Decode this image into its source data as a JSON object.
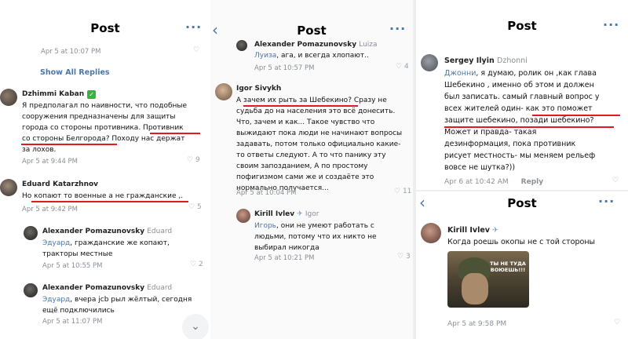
{
  "panel1": {
    "title": "Post",
    "more_icon": "···",
    "top_time": "Apr 5 at 10:07 PM",
    "show_all": "Show All Replies",
    "c1": {
      "name": "Dzhimmi Kaban",
      "badge": "✓",
      "line1": "Я предполагал по наивности, что подобные",
      "line2": "сооружения предназначены для защиты",
      "line3a": "города со стороны противника. ",
      "line3b": "Противник",
      "line4a": "со стороны Белгорода?",
      "line4b": " Походу нас держат",
      "line5": "за лохов.",
      "time": "Apr 5 at 9:44 PM",
      "likes": "9"
    },
    "c2": {
      "name": "Eduard Katarzhnov",
      "textA": "Но ",
      "textB": "копают то военные а не гражданские",
      "textC": " ,.",
      "time": "Apr 5 at 9:42 PM",
      "likes": "5"
    },
    "c3": {
      "name": "Alexander Pomazunovsky",
      "reply_to": "Eduard",
      "mention": "Эдуард",
      "line1": ", гражданские же копают,",
      "line2": "тракторы местные",
      "time": "Apr 5 at 10:55 PM",
      "likes": "2"
    },
    "c4": {
      "name": "Alexander Pomazunovsky",
      "reply_to": "Eduard",
      "mention": "Эдуард",
      "line1": ", вчера jcb рыл жёлтый, сегодня",
      "line2": "ещё подключились",
      "time": "Apr 5 at 11:07 PM"
    }
  },
  "panel2": {
    "title": "Post",
    "more_icon": "···",
    "c0": {
      "name": "Alexander Pomazunovsky",
      "reply_to": "Luiza",
      "mention": "Луиза",
      "text": ", ага, и всегда хлопают..",
      "time": "Apr 5 at 10:57 PM",
      "likes": "4"
    },
    "c1": {
      "name": "Igor Sivykh",
      "line1a": "А ",
      "line1b": "зачем их рыть за Шебекино",
      "line1c": "? Сразу не",
      "line2": "судьба до на населения это всё донесить.",
      "line3": "Что, зачем и как... Такое чувство что",
      "line4": "выжидают пока люди не начинают вопросы",
      "line5": "задавать, потом только официально какие-",
      "line6": "то ответы следуют. А то что панику эту",
      "line7": "своим запозданием, А по простому",
      "line8": "пофигизмом сами же и создаёте это",
      "line9": "нормально получается...",
      "time": "Apr 5 at 10:04 PM",
      "likes": "11"
    },
    "c2": {
      "name": "Kirill Ivlev",
      "reply_to": "Igor",
      "mention": "Игорь",
      "line1": ", они не умеют работать с",
      "line2": "людьми, потому что их никто не",
      "line3": "выбирал никогда",
      "time": "Apr 5 at 10:21 PM",
      "likes": "3"
    }
  },
  "panel3": {
    "title": "Post",
    "more_icon": "···",
    "c1": {
      "name": "Sergey Ilyin",
      "reply_to": "Dzhonni",
      "mention": "Джонни",
      "line1": ", я думаю, ролик он ,как глава",
      "line2": "Шебекино , именно об этом и должен",
      "line3": "был записать. самый главный вопрос у",
      "line4a": "всех жителей один- ",
      "line4b": "как это поможет",
      "line5a": "защите шебекино, позади шебекино?",
      "line6": "Может и правда- такая",
      "line7": "дезинформация, пока противник",
      "line8": "рисует местность- мы меняем рельеф",
      "line9": "вовсе не шутка?))",
      "time": "Apr 6 at 10:42 AM",
      "reply_label": "Reply"
    }
  },
  "panel4": {
    "title": "Post",
    "more_icon": "···",
    "c1": {
      "name": "Kirill Ivlev",
      "text": "Когда роешь окопы не с той стороны",
      "sticker_text": "ТЫ НЕ ТУДА ВОЮЕШЬ!!!",
      "time": "Apr 5 at 9:58 PM"
    }
  }
}
